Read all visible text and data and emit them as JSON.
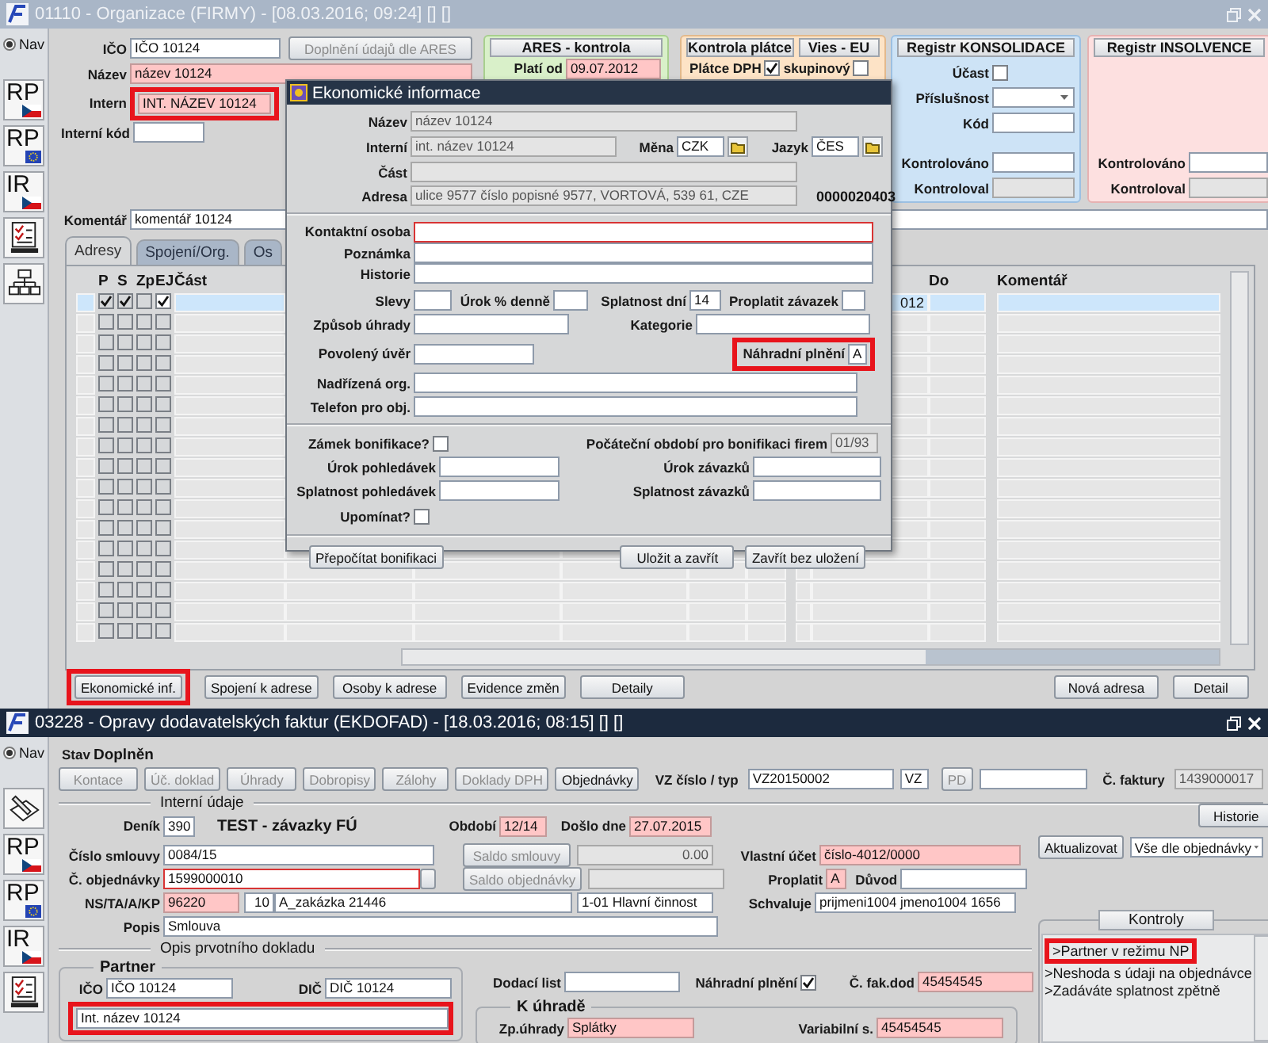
{
  "top_window": {
    "title": "01110 - Organizace (FIRMY) - [08.03.2016; 09:24] [] []",
    "active": false,
    "nav": {
      "label": "Nav",
      "selected": true
    },
    "nav_icons": [
      {
        "kind": "rp_cz",
        "label": "RP"
      },
      {
        "kind": "rp_eu",
        "label": "RP"
      },
      {
        "kind": "ir_cz",
        "label": "IR"
      },
      {
        "kind": "tasks"
      },
      {
        "kind": "org"
      }
    ],
    "ico": {
      "label": "IČO",
      "value": "IČO 10124"
    },
    "ares_button": {
      "label": "Doplnění údajů dle ARES",
      "disabled": true
    },
    "name": {
      "label": "Název",
      "value": "název 10124",
      "required": true
    },
    "internal": {
      "label": "Intern",
      "value": "INT. NÁZEV 10124",
      "required": true,
      "highlighted": true
    },
    "internal_code": {
      "label": "Interní kód"
    },
    "ares_panel": {
      "title": "ARES - kontrola",
      "valid_from": {
        "label": "Platí od",
        "value": "09.07.2012",
        "required": true
      }
    },
    "vat_panel": {
      "title": "Kontrola plátce",
      "label": "Plátce DPH",
      "checked": true
    },
    "vies_panel": {
      "title": "Vies - EU",
      "label": "skupinový",
      "checked": false
    },
    "consolidation_panel": {
      "title": "Registr KONSOLIDACE",
      "participation": {
        "label": "Účast",
        "checked": false
      },
      "membership": {
        "label": "Příslušnost"
      },
      "code": {
        "label": "Kód"
      },
      "checked_on": {
        "label": "Kontrolováno"
      },
      "checked_by": {
        "label": "Kontroloval",
        "readonly": true
      }
    },
    "insolvency_panel": {
      "title": "Registr INSOLVENCE",
      "checked_on": {
        "label": "Kontrolováno"
      },
      "checked_by": {
        "label": "Kontroloval",
        "readonly": true
      }
    },
    "comment": {
      "label": "Komentář",
      "value": "komentář 10124"
    },
    "tabs": [
      {
        "label": "Adresy",
        "selected": true
      },
      {
        "label": "Spojení/Org.",
        "selected": false
      },
      {
        "label": "Os",
        "selected": false
      }
    ],
    "table": {
      "columns": [
        "P",
        "S",
        "Zp",
        "EJ",
        "Část",
        "Do",
        "Komentář"
      ],
      "rows": [
        {
          "selected": true,
          "p": true,
          "s": true,
          "zp": false,
          "ej": true,
          "column_7": "012"
        },
        {
          "selected": false,
          "p": false,
          "s": false,
          "zp": false,
          "ej": false
        },
        {
          "selected": false,
          "p": false,
          "s": false,
          "zp": false,
          "ej": false
        },
        {
          "selected": false,
          "p": false,
          "s": false,
          "zp": false,
          "ej": false
        },
        {
          "selected": false,
          "p": false,
          "s": false,
          "zp": false,
          "ej": false
        },
        {
          "selected": false,
          "p": false,
          "s": false,
          "zp": false,
          "ej": false
        },
        {
          "selected": false,
          "p": false,
          "s": false,
          "zp": false,
          "ej": false
        },
        {
          "selected": false,
          "p": false,
          "s": false,
          "zp": false,
          "ej": false
        },
        {
          "selected": false,
          "p": false,
          "s": false,
          "zp": false,
          "ej": false
        },
        {
          "selected": false,
          "p": false,
          "s": false,
          "zp": false,
          "ej": false
        },
        {
          "selected": false,
          "p": false,
          "s": false,
          "zp": false,
          "ej": false
        },
        {
          "selected": false,
          "p": false,
          "s": false,
          "zp": false,
          "ej": false
        },
        {
          "selected": false,
          "p": false,
          "s": false,
          "zp": false,
          "ej": false
        },
        {
          "selected": false,
          "p": false,
          "s": false,
          "zp": false,
          "ej": false
        },
        {
          "selected": false,
          "p": false,
          "s": false,
          "zp": false,
          "ej": false
        },
        {
          "selected": false,
          "p": false,
          "s": false,
          "zp": false,
          "ej": false
        },
        {
          "selected": false,
          "p": false,
          "s": false,
          "zp": false,
          "ej": false
        }
      ]
    },
    "buttons": [
      {
        "label": "Ekonomické inf.",
        "highlighted": true
      },
      {
        "label": "Spojení k adrese",
        "highlighted": false
      },
      {
        "label": "Osoby k adrese",
        "highlighted": false
      },
      {
        "label": "Evidence změn",
        "highlighted": false
      },
      {
        "label": "Detaily",
        "highlighted": false
      },
      {
        "label": "Nová adresa",
        "highlighted": false
      },
      {
        "label": "Detail",
        "highlighted": false
      }
    ]
  },
  "dialog": {
    "title": "Ekonomické informace",
    "name": {
      "label": "Název",
      "value": "název 10124",
      "readonly": true
    },
    "internal": {
      "label": "Interní",
      "value": "int. název 10124",
      "readonly": true
    },
    "currency": {
      "label": "Měna",
      "value": "CZK"
    },
    "language": {
      "label": "Jazyk",
      "value": "ČES"
    },
    "part": {
      "label": "Část",
      "readonly": true
    },
    "address": {
      "label": "Adresa",
      "value": "ulice 9577 číslo popisné 9577, VORTOVÁ, 539 61, CZE",
      "readonly": true
    },
    "number": "0000020403",
    "contact": {
      "label": "Kontaktní osoba",
      "invalid": true
    },
    "note": {
      "label": "Poznámka"
    },
    "history": {
      "label": "Historie"
    },
    "discounts": {
      "label": "Slevy"
    },
    "interest": {
      "label": "Úrok % denně"
    },
    "due_days": {
      "label": "Splatnost dní",
      "value": "14"
    },
    "pay_liability": {
      "label": "Proplatit závazek"
    },
    "payment_method": {
      "label": "Způsob úhrady"
    },
    "category": {
      "label": "Kategorie"
    },
    "credit": {
      "label": "Povolený úvěr"
    },
    "substitute": {
      "label": "Náhradní plnění",
      "value": "A",
      "highlighted": true
    },
    "parent_org": {
      "label": "Nadřízená org."
    },
    "order_phone": {
      "label": "Telefon pro obj."
    },
    "bonus_lock": {
      "label": "Zámek bonifikace?",
      "checked": false
    },
    "bonus_period": {
      "label": "Počáteční období pro bonifikaci firem",
      "value": "01/93",
      "readonly": true
    },
    "receivable_interest": {
      "label": "Úrok pohledávek"
    },
    "liability_interest": {
      "label": "Úrok závazků"
    },
    "receivable_due": {
      "label": "Splatnost pohledávek"
    },
    "liability_due": {
      "label": "Splatnost závazků"
    },
    "remind": {
      "label": "Upomínat?",
      "checked": false
    },
    "buttons": [
      "Přepočítat bonifikaci",
      "Uložit a zavřít",
      "Zavřít bez uložení"
    ]
  },
  "bottom_window": {
    "title": "03228 - Opravy dodavatelských faktur (EKDOFAD) - [18.03.2016; 08:15] [] []",
    "active": true,
    "nav": {
      "label": "Nav",
      "selected": true
    },
    "nav_icons": [
      {
        "kind": "edit"
      },
      {
        "kind": "rp_cz",
        "label": "RP"
      },
      {
        "kind": "rp_eu",
        "label": "RP"
      },
      {
        "kind": "ir_cz",
        "label": "IR"
      },
      {
        "kind": "tasks"
      }
    ],
    "status": {
      "label": "Stav",
      "value": "Doplněn"
    },
    "tool_buttons": [
      {
        "label": "Kontace",
        "disabled": true
      },
      {
        "label": "Úč. doklad",
        "disabled": true
      },
      {
        "label": "Úhrady",
        "disabled": true
      },
      {
        "label": "Dobropisy",
        "disabled": true
      },
      {
        "label": "Zálohy",
        "disabled": true
      },
      {
        "label": "Doklady DPH",
        "disabled": true
      },
      {
        "label": "Objednávky",
        "disabled": false
      }
    ],
    "vz": {
      "label": "VZ číslo / typ",
      "value": "VZ20150002"
    },
    "vz_type": {
      "value": "VZ"
    },
    "pd_button": {
      "label": "PD",
      "disabled": true
    },
    "invoice_no": {
      "label": "Č. faktury",
      "value": "1439000017",
      "readonly": true
    },
    "internal_section": "Interní údaje",
    "journal": {
      "label": "Deník",
      "value": "390",
      "name": "TEST - závazky FÚ"
    },
    "period": {
      "label": "Období",
      "value": "12/14",
      "required": true
    },
    "received": {
      "label": "Došlo dne",
      "value": "27.07.2015",
      "required": true
    },
    "history_button": "Historie",
    "contract": {
      "label": "Číslo smlouvy",
      "value": "0084/15"
    },
    "contract_balance_button": {
      "label": "Saldo smlouvy",
      "disabled": true
    },
    "contract_balance": {
      "value": "0.00",
      "readonly": true
    },
    "own_account": {
      "label": "Vlastní účet",
      "value": "číslo-4012/0000",
      "required": true
    },
    "update_button": "Aktualizovat",
    "update_mode": "Vše dle objednávky",
    "order": {
      "label": "Č. objednávky",
      "value": "1599000010",
      "invalid": true
    },
    "order_balance_button": {
      "label": "Saldo objednávky",
      "disabled": true
    },
    "order_balance": {
      "readonly": true
    },
    "pay": {
      "label": "Proplatit",
      "value": "A",
      "required": true
    },
    "reason": {
      "label": "Důvod"
    },
    "cost": {
      "label": "NS/TA/A/KP",
      "center": {
        "value": "96220",
        "required": true
      },
      "job_no": {
        "value": "10"
      },
      "job": {
        "value": "A_zakázka 21446"
      },
      "activity": {
        "value": "1-01 Hlavní činnost"
      }
    },
    "approver": {
      "label": "Schvaluje",
      "value": "prijmeni1004 jmeno1004 1656"
    },
    "description": {
      "label": "Popis",
      "value": "Smlouva"
    },
    "checks": {
      "title": "Kontroly",
      "messages": [
        {
          "text": ">Partner v režimu NP",
          "highlighted": true
        },
        {
          "text": ">Neshoda s údaji na objednávce",
          "highlighted": false
        },
        {
          "text": ">Zadáváte splatnost zpětně",
          "highlighted": false
        }
      ]
    },
    "source_section": "Opis prvotního dokladu",
    "partner": {
      "title": "Partner",
      "ico": {
        "label": "IČO",
        "value": "IČO 10124"
      },
      "dic": {
        "label": "DIČ",
        "value": "DIČ 10124"
      },
      "name": {
        "value": "Int. název 10124",
        "highlighted": true
      }
    },
    "delivery_note": {
      "label": "Dodací list"
    },
    "substitute": {
      "label": "Náhradní plnění",
      "checked": true
    },
    "supplier_invoice": {
      "label": "Č. fak.dod",
      "value": "45454545",
      "required": true
    },
    "payment": {
      "title": "K úhradě",
      "method": {
        "label": "Zp.úhrady",
        "value": "Splátky",
        "required": true
      },
      "variable_symbol": {
        "label": "Variabilní s.",
        "value": "45454545",
        "required": true
      }
    }
  }
}
